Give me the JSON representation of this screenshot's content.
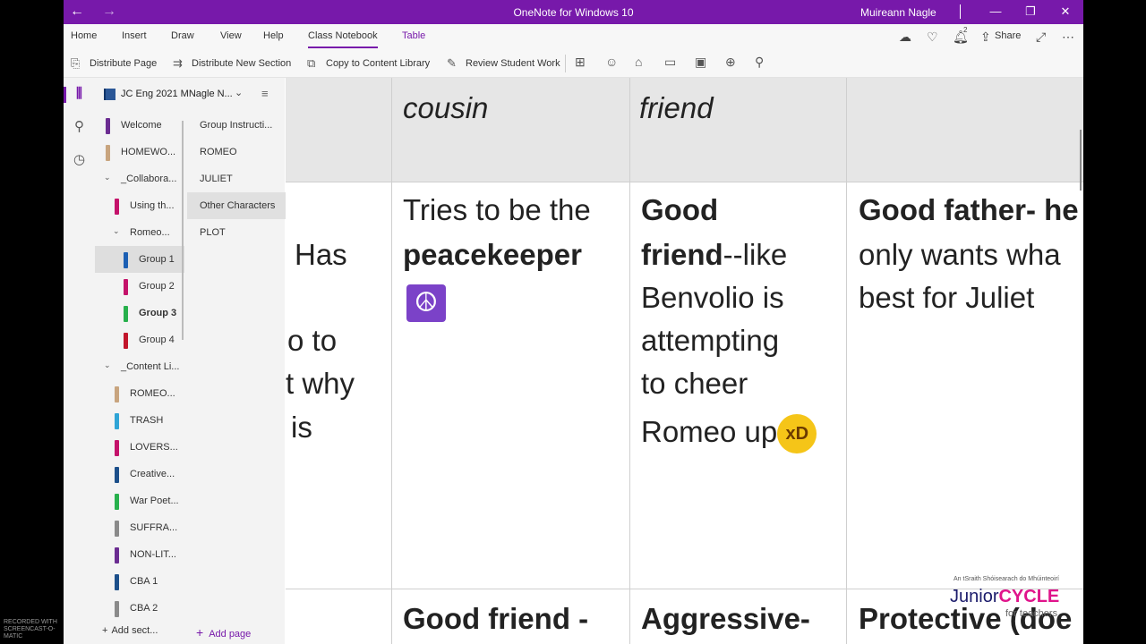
{
  "titlebar": {
    "title": "OneNote for Windows 10",
    "user": "Muireann Nagle",
    "back": "←",
    "forward": "→",
    "minimize": "—",
    "maximize": "❐",
    "close": "✕"
  },
  "menu": {
    "items": [
      "Home",
      "Insert",
      "Draw",
      "View",
      "Help",
      "Class Notebook",
      "Table"
    ],
    "active": "Class Notebook",
    "share": "Share",
    "notif_count": "2"
  },
  "toolbar": {
    "distribute_page": "Distribute Page",
    "distribute_new_section": "Distribute New Section",
    "copy_to_content_library": "Copy to Content Library",
    "review_student_work": "Review Student Work"
  },
  "notebook": {
    "name": "JC Eng 2021 MNagle N..."
  },
  "sections": [
    {
      "label": "Welcome",
      "color": "#6b2c91",
      "indent": 0
    },
    {
      "label": "HOMEWO...",
      "color": "#c8a47e",
      "indent": 0
    },
    {
      "label": "_Collabora...",
      "indent": 0,
      "group": true,
      "arrow": "⌄"
    },
    {
      "label": "Using th...",
      "color": "#c4126a",
      "indent": 1
    },
    {
      "label": "Romeo...",
      "indent": 1,
      "group": true,
      "arrow": "⌄"
    },
    {
      "label": "Group 1",
      "color": "#1c5fb3",
      "indent": 2,
      "selected": true
    },
    {
      "label": "Group 2",
      "color": "#c4126a",
      "indent": 2
    },
    {
      "label": "Group 3",
      "color": "#27b04c",
      "indent": 2,
      "bold": true
    },
    {
      "label": "Group 4",
      "color": "#c2152b",
      "indent": 2
    },
    {
      "label": "_Content Li...",
      "indent": 0,
      "group": true,
      "arrow": "⌄"
    },
    {
      "label": "ROMEO...",
      "color": "#c8a47e",
      "indent": 1
    },
    {
      "label": "TRASH",
      "color": "#2fa4d6",
      "indent": 1
    },
    {
      "label": "LOVERS...",
      "color": "#c4126a",
      "indent": 1
    },
    {
      "label": "Creative...",
      "color": "#1c4f8a",
      "indent": 1
    },
    {
      "label": "War Poet...",
      "color": "#27b04c",
      "indent": 1
    },
    {
      "label": "SUFFRA...",
      "color": "#8a8a8a",
      "indent": 1
    },
    {
      "label": "NON-LIT...",
      "color": "#6b2c91",
      "indent": 1
    },
    {
      "label": "CBA 1",
      "color": "#1c4f8a",
      "indent": 1
    },
    {
      "label": "CBA 2",
      "color": "#8a8a8a",
      "indent": 1
    }
  ],
  "add_section": "Add sect...",
  "add_page": "Add page",
  "pages": [
    {
      "label": "Group Instructi..."
    },
    {
      "label": "ROMEO"
    },
    {
      "label": "JULIET"
    },
    {
      "label": "Other Characters",
      "selected": true
    },
    {
      "label": "PLOT"
    }
  ],
  "table": {
    "header_cells": [
      "cousin",
      "friend"
    ],
    "row1": {
      "col0_lines": [
        "Has",
        "",
        "o to",
        "t why",
        "is"
      ],
      "col1_line1": "Tries to be the",
      "col1_bold": "peacekeeper",
      "col1_emoji": "☮",
      "col2_bold1": "Good",
      "col2_bold2": "friend",
      "col2_rest": "--like",
      "col2_lines": [
        "Benvolio is",
        "attempting",
        "to cheer"
      ],
      "col2_last": "Romeo up",
      "col2_emoji": "xD",
      "col3_bold": "Good father- he",
      "col3_lines": [
        "only wants wha",
        "best for Juliet"
      ]
    },
    "row2": {
      "col1": "Good friend -",
      "col2": "Aggressive-",
      "col3": "Protective (doe"
    }
  },
  "watermark": {
    "small": "An tSraith Shóisearach do Mhúinteoirí",
    "junior": "Junior",
    "cycle": "CYCLE",
    "for_teachers": "for teachers",
    "screencast": "RECORDED WITH SCREENCAST-O-MATIC"
  }
}
